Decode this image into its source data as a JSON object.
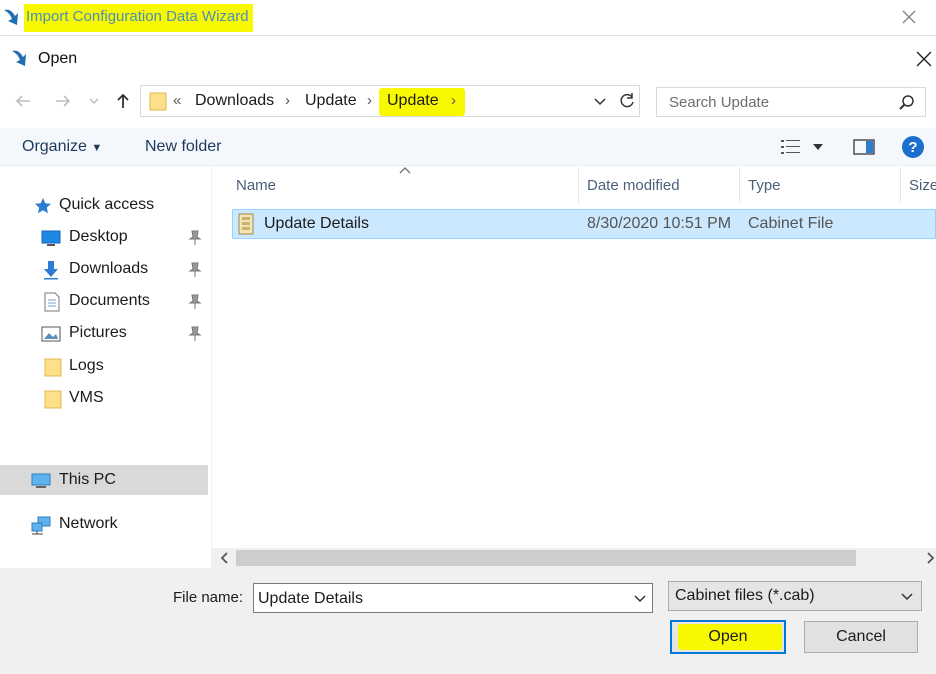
{
  "wizard": {
    "title": "Import Configuration Data Wizard"
  },
  "dialog": {
    "title": "Open"
  },
  "address": {
    "overflow": "«",
    "crumbs": [
      "Downloads",
      "Update",
      "Update"
    ]
  },
  "search": {
    "placeholder": "Search Update"
  },
  "toolbar": {
    "organize_label": "Organize",
    "new_folder_label": "New folder"
  },
  "sidebar": {
    "items": [
      {
        "label": "Quick access"
      },
      {
        "label": "Desktop"
      },
      {
        "label": "Downloads"
      },
      {
        "label": "Documents"
      },
      {
        "label": "Pictures"
      },
      {
        "label": "Logs"
      },
      {
        "label": "VMS"
      },
      {
        "label": "This PC"
      },
      {
        "label": "Network"
      }
    ]
  },
  "filelist": {
    "columns": [
      "Name",
      "Date modified",
      "Type",
      "Size"
    ],
    "rows": [
      {
        "name": "Update Details",
        "date_modified": "8/30/2020 10:51 PM",
        "type": "Cabinet File"
      }
    ]
  },
  "footer": {
    "file_name_label": "File name:",
    "file_name_value": "Update Details",
    "file_type_value": "Cabinet files (*.cab)",
    "open_label": "Open",
    "cancel_label": "Cancel"
  },
  "colors": {
    "highlight": "#f8f800",
    "selection": "#cce8ff",
    "accent": "#0078d7"
  }
}
